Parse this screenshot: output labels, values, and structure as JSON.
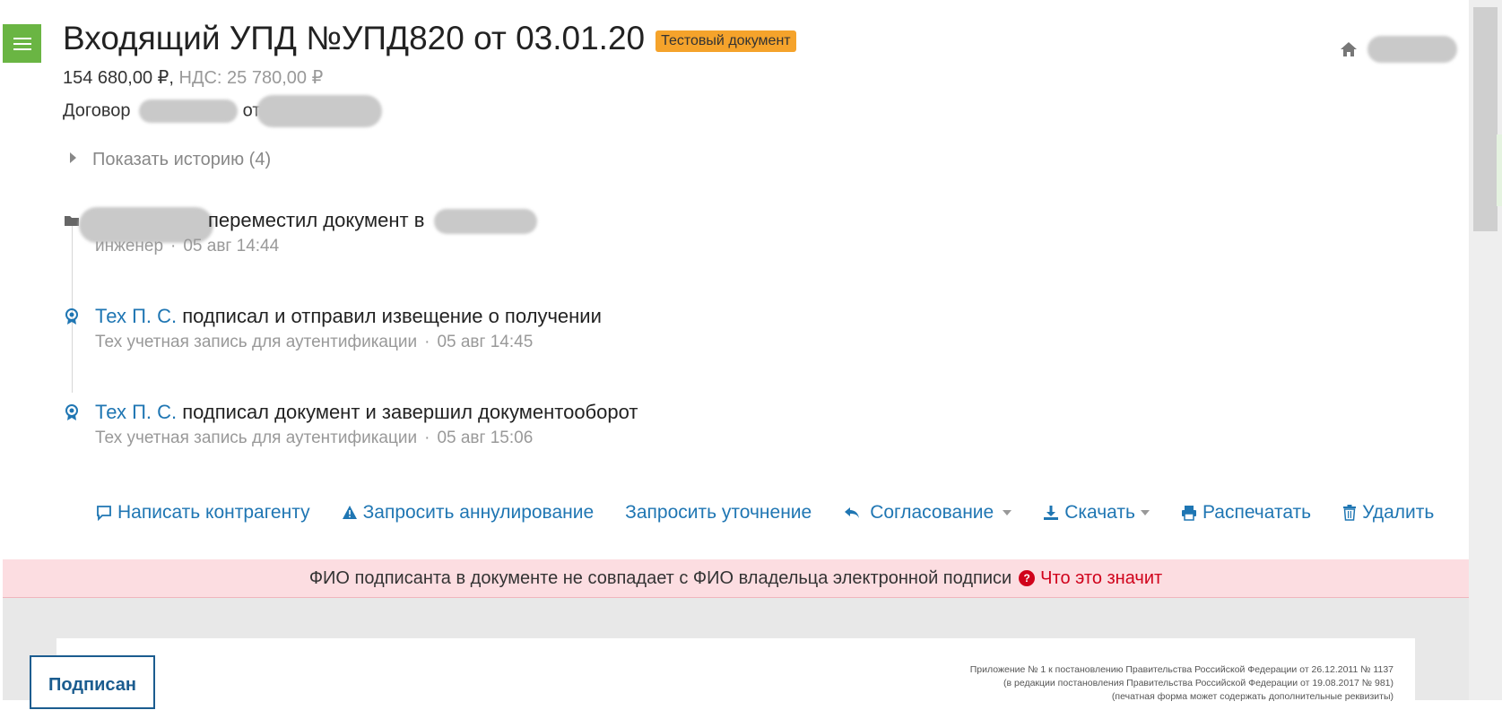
{
  "header": {
    "title": "Входящий УПД №УПД820 от 03.01.20",
    "badge": "Тестовый документ",
    "sum": "154 680,00 ₽,",
    "vat": "НДС: 25 780,00 ₽",
    "contract_prefix": "Договор",
    "contract_mid": "от"
  },
  "history": {
    "toggle_label": "Показать историю (4)"
  },
  "events": [
    {
      "actor": "",
      "action": "переместил документ в",
      "role": "инженер",
      "time": "05 авг 14:44",
      "icon": "folder-icon"
    },
    {
      "actor": "Тех П. С.",
      "action": "подписал и отправил извещение о получении",
      "role": "Тех учетная запись для аутентификации",
      "time": "05 авг 14:45",
      "icon": "award-icon"
    },
    {
      "actor": "Тех П. С.",
      "action": "подписал документ и завершил документооборот",
      "role": "Тех учетная запись для аутентификации",
      "time": "05 авг 15:06",
      "icon": "award-icon"
    }
  ],
  "actions": {
    "write": "Написать контрагенту",
    "cancel": "Запросить аннулирование",
    "clarify": "Запросить уточнение",
    "approve": "Согласование",
    "download": "Скачать",
    "print": "Распечатать",
    "delete": "Удалить"
  },
  "warning": {
    "text": "ФИО подписанта в документе не совпадает с ФИО владельца электронной подписи",
    "link": "Что это значит"
  },
  "document": {
    "note1": "Приложение № 1 к постановлению Правительства Российской Федерации от 26.12.2011 № 1137",
    "note2": "(в редакции постановления Правительства Российской Федерации от 19.08.2017 № 981)",
    "note3": "(печатная форма может содержать дополнительные реквизиты)",
    "stamp": "Подписан"
  },
  "colors": {
    "accent": "#1f76b3",
    "menu": "#6ab543",
    "badge": "#f5a32b",
    "warning_bg": "#fcdde1",
    "warning_link": "#d0021b"
  }
}
